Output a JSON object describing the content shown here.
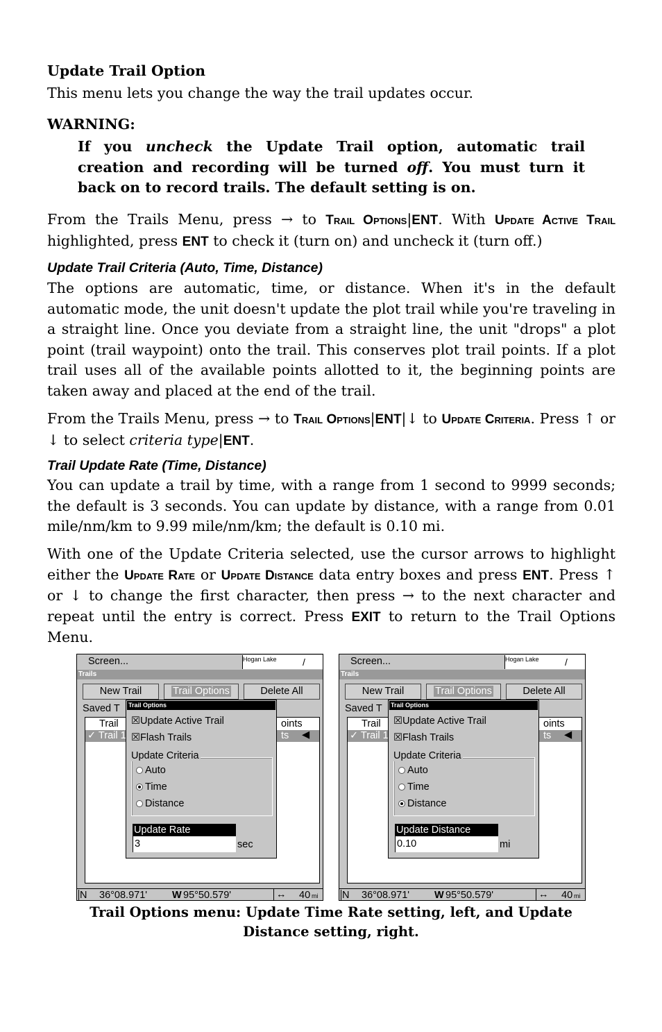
{
  "heading": "Update Trail Option",
  "intro": "This menu lets you change the way the trail updates occur.",
  "warning": {
    "label": "WARNING:",
    "t1": "If you ",
    "t2": "uncheck",
    "t3": " the Update Trail option, automatic trail creation and recording will be turned ",
    "t4": "off",
    "t5": ". You must turn it back on to record trails. The default setting is on."
  },
  "p2": {
    "t1": "From the Trails Menu, press → to ",
    "k1": "Trail Options",
    "sep": "|",
    "k2": "ENT",
    "t2": ". With ",
    "k3": "Update Active Trail",
    "t3": " highlighted, press ",
    "k4": "ENT",
    "t4": " to check it (turn on) and uncheck it (turn off.)"
  },
  "sub1": "Update Trail Criteria (Auto, Time, Distance)",
  "p3": "The options are automatic, time, or distance. When it's in the default automatic mode, the unit doesn't update the plot trail while you're traveling in a straight line. Once you deviate from a straight line, the unit \"drops\" a plot point (trail waypoint) onto the trail. This conserves plot trail points. If a plot trail uses all of the available points allotted to it, the beginning points are taken away and placed at the end of the trail.",
  "p4": {
    "t1": "From the Trails Menu, press → to ",
    "k1": "Trail Options",
    "sep": "|",
    "k2": "ENT",
    "t2": "|↓ to ",
    "k3": "Update Criteria",
    "t3": ". Press ↑ or ↓ to select ",
    "t4": "criteria type",
    "k4": "ENT",
    "t5": "."
  },
  "sub2": "Trail Update Rate (Time, Distance)",
  "p5": "You can update a trail by time, with a range from 1 second to 9999 seconds; the default is 3 seconds. You can update by distance, with a range from 0.01 mile/nm/km to 9.99 mile/nm/km; the default is 0.10 mi.",
  "p6": {
    "t1": "With one of the Update Criteria selected, use the cursor arrows to highlight either the ",
    "k1": "Update Rate",
    "t2": " or ",
    "k2": "Update Distance",
    "t3": " data entry boxes and press ",
    "k3": "ENT",
    "t4": ". Press ↑ or ↓ to change the first character, then press → to the next character and repeat until the entry is correct. Press ",
    "k4": "EXIT",
    "t5": " to return to the Trail Options Menu."
  },
  "screens": [
    {
      "menu": "Screen...",
      "map_label": "Hogan Lake",
      "title": "Trails",
      "buttons": [
        "New Trail",
        "Trail Options",
        "Delete All"
      ],
      "saved": "Saved T",
      "row1": "Trail",
      "row1_right": "oints",
      "row2": "✓ Trail 1",
      "row2_right": "ts",
      "popup_title": "Trail Options",
      "opt1": "Update Active Trail",
      "opt2": "Flash Trails",
      "group": "Update Criteria",
      "radios": [
        "Auto",
        "Time",
        "Distance"
      ],
      "selected": 1,
      "field_label": "Update Rate",
      "field_value": "3",
      "unit": "sec",
      "lat_h": "N",
      "lat": "36°08.971'",
      "lon_h": "W",
      "lon": "95°50.579'",
      "scale": "40",
      "scale_unit": "mi"
    },
    {
      "menu": "Screen...",
      "map_label": "Hogan Lake",
      "title": "Trails",
      "buttons": [
        "New Trail",
        "Trail Options",
        "Delete All"
      ],
      "saved": "Saved T",
      "row1": "Trail",
      "row1_right": "oints",
      "row2": "✓ Trail 1",
      "row2_right": "ts",
      "popup_title": "Trail Options",
      "opt1": "Update Active Trail",
      "opt2": "Flash Trails",
      "group": "Update Criteria",
      "radios": [
        "Auto",
        "Time",
        "Distance"
      ],
      "selected": 2,
      "field_label": "Update Distance",
      "field_value": "0.10",
      "unit": "mi",
      "lat_h": "N",
      "lat": "36°08.971'",
      "lon_h": "W",
      "lon": "95°50.579'",
      "scale": "40",
      "scale_unit": "mi"
    }
  ],
  "caption": "Trail Options menu: Update Time Rate setting, left, and Update Distance setting, right."
}
